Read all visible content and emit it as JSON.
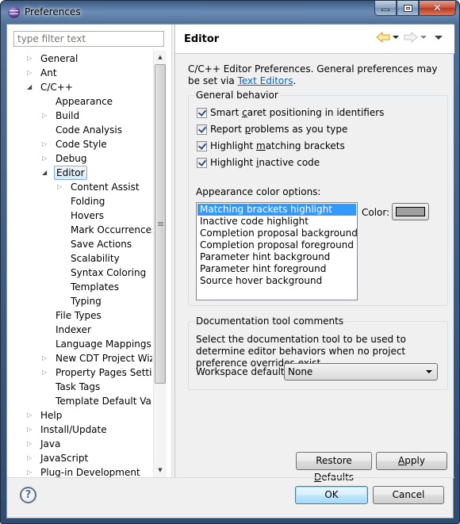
{
  "window": {
    "title": "Preferences",
    "controls": {
      "minimize": "minimize",
      "maximize": "maximize",
      "close": "✕"
    }
  },
  "filter": {
    "placeholder": "type filter text",
    "value": ""
  },
  "tree": [
    {
      "label": "General",
      "level": 0,
      "toggle": "collapsed"
    },
    {
      "label": "Ant",
      "level": 0,
      "toggle": "collapsed"
    },
    {
      "label": "C/C++",
      "level": 0,
      "toggle": "expanded"
    },
    {
      "label": "Appearance",
      "level": 1,
      "toggle": "none"
    },
    {
      "label": "Build",
      "level": 1,
      "toggle": "collapsed"
    },
    {
      "label": "Code Analysis",
      "level": 1,
      "toggle": "none"
    },
    {
      "label": "Code Style",
      "level": 1,
      "toggle": "collapsed"
    },
    {
      "label": "Debug",
      "level": 1,
      "toggle": "collapsed"
    },
    {
      "label": "Editor",
      "level": 1,
      "toggle": "expanded",
      "selected": true
    },
    {
      "label": "Content Assist",
      "level": 2,
      "toggle": "collapsed"
    },
    {
      "label": "Folding",
      "level": 2,
      "toggle": "none"
    },
    {
      "label": "Hovers",
      "level": 2,
      "toggle": "none"
    },
    {
      "label": "Mark Occurrences",
      "level": 2,
      "toggle": "none"
    },
    {
      "label": "Save Actions",
      "level": 2,
      "toggle": "none"
    },
    {
      "label": "Scalability",
      "level": 2,
      "toggle": "none"
    },
    {
      "label": "Syntax Coloring",
      "level": 2,
      "toggle": "none"
    },
    {
      "label": "Templates",
      "level": 2,
      "toggle": "none"
    },
    {
      "label": "Typing",
      "level": 2,
      "toggle": "none"
    },
    {
      "label": "File Types",
      "level": 1,
      "toggle": "none"
    },
    {
      "label": "Indexer",
      "level": 1,
      "toggle": "none"
    },
    {
      "label": "Language Mappings",
      "level": 1,
      "toggle": "none"
    },
    {
      "label": "New CDT Project Wizard",
      "level": 1,
      "toggle": "collapsed"
    },
    {
      "label": "Property Pages Settings",
      "level": 1,
      "toggle": "collapsed"
    },
    {
      "label": "Task Tags",
      "level": 1,
      "toggle": "none"
    },
    {
      "label": "Template Default Values",
      "level": 1,
      "toggle": "none"
    },
    {
      "label": "Help",
      "level": 0,
      "toggle": "collapsed"
    },
    {
      "label": "Install/Update",
      "level": 0,
      "toggle": "collapsed"
    },
    {
      "label": "Java",
      "level": 0,
      "toggle": "collapsed"
    },
    {
      "label": "JavaScript",
      "level": 0,
      "toggle": "collapsed"
    },
    {
      "label": "Plug-in Development",
      "level": 0,
      "toggle": "collapsed"
    }
  ],
  "tree_scroll": {
    "position_fraction": 0.0,
    "visible_fraction": 0.8
  },
  "page": {
    "title": "Editor",
    "description_text": "C/C++ Editor Preferences. General preferences may be set via",
    "description_link": "Text Editors",
    "description_suffix": ".",
    "nav": {
      "back": "back",
      "forward": "forward",
      "view_menu": "view menu"
    }
  },
  "general_behavior": {
    "legend": "General behavior",
    "options": [
      {
        "pre": "Smart ",
        "mnemonic": "c",
        "post": "aret positioning in identifiers",
        "checked": true
      },
      {
        "pre": "Report ",
        "mnemonic": "p",
        "post": "roblems as you type",
        "checked": true
      },
      {
        "pre": "Highlight ",
        "mnemonic": "m",
        "post": "atching brackets",
        "checked": true
      },
      {
        "pre": "Highlight ",
        "mnemonic": "i",
        "post": "nactive code",
        "checked": true
      }
    ],
    "appearance_label": "Appearance color options:",
    "appearance_options": [
      "Matching brackets highlight",
      "Inactive code highlight",
      "Completion proposal background",
      "Completion proposal foreground",
      "Parameter hint background",
      "Parameter hint foreground",
      "Source hover background"
    ],
    "selected_index": 0,
    "color_label": "Color:",
    "color_value": "#a0a0a0"
  },
  "documentation": {
    "legend": "Documentation tool comments",
    "description": "Select the documentation tool to be used to determine editor behaviors when no project preference overrides exist",
    "workspace_label": "Workspace default:",
    "workspace_value": "None"
  },
  "buttons": {
    "restore_pre": "Restore ",
    "restore_mnemonic": "D",
    "restore_post": "efaults",
    "apply_mnemonic": "A",
    "apply_post": "pply",
    "ok": "OK",
    "cancel": "Cancel",
    "help": "?"
  }
}
